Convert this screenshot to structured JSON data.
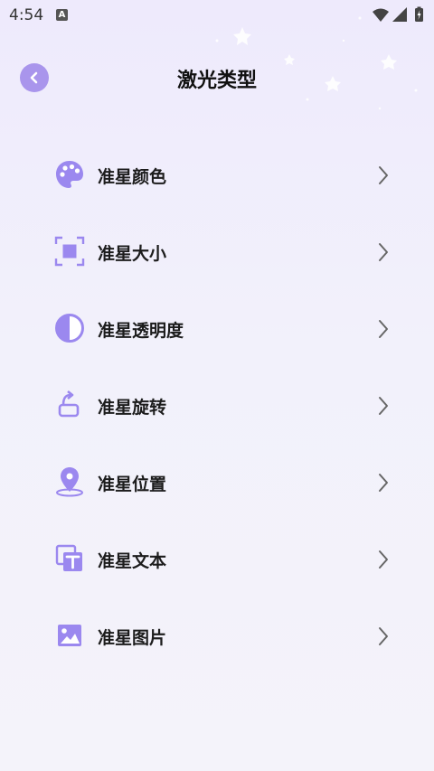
{
  "status_bar": {
    "time": "4:54",
    "notification_icon_letter": "A"
  },
  "header": {
    "title": "激光类型",
    "back_icon": "chevron-left-icon"
  },
  "menu": {
    "items": [
      {
        "label": "准星颜色",
        "icon": "palette-icon"
      },
      {
        "label": "准星大小",
        "icon": "resize-frame-icon"
      },
      {
        "label": "准星透明度",
        "icon": "half-circle-contrast-icon"
      },
      {
        "label": "准星旋转",
        "icon": "rotate-icon"
      },
      {
        "label": "准星位置",
        "icon": "location-pin-icon"
      },
      {
        "label": "准星文本",
        "icon": "text-box-icon"
      },
      {
        "label": "准星图片",
        "icon": "image-icon"
      }
    ]
  },
  "colors": {
    "accent": "#9b88ef",
    "back_button": "#a995ec",
    "background": "#f2f1fb"
  }
}
